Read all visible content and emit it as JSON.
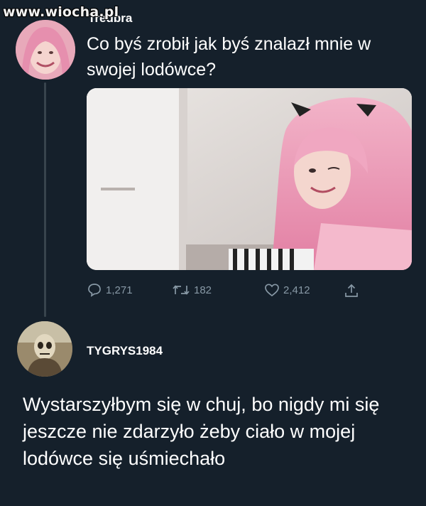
{
  "watermark": "www.wiocha.pl",
  "tweet": {
    "username": "Tredbra",
    "text": "Co byś zrobił jak byś znalazł mnie w swojej lodówce?",
    "media_alt": "photo",
    "actions": {
      "reply_count": "1,271",
      "retweet_count": "182",
      "like_count": "2,412"
    }
  },
  "reply": {
    "username": "TYGRYS1984",
    "text": "Wystarszyłbym się w chuj, bo nigdy mi się jeszcze nie zdarzyło żeby ciało w mojej lodówce się uśmiechało"
  },
  "icons": {
    "reply": "comment-icon",
    "retweet": "retweet-icon",
    "like": "heart-icon",
    "share": "share-icon"
  },
  "colors": {
    "background": "#15202b",
    "muted": "#8899a6",
    "text": "#ffffff"
  }
}
